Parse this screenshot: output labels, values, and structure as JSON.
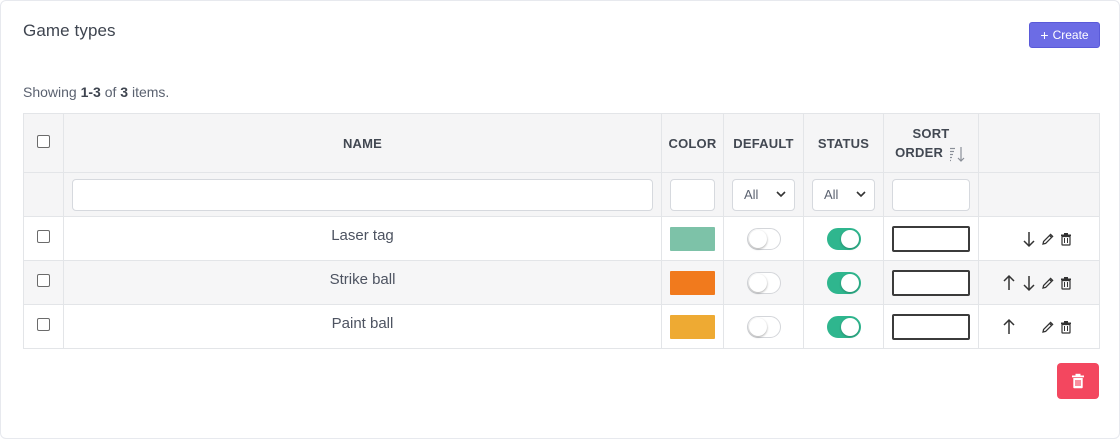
{
  "header": {
    "title": "Game types",
    "create_label": "Create"
  },
  "summary": {
    "prefix": "Showing ",
    "range": "1-3",
    "of": " of ",
    "total": "3",
    "suffix": " items."
  },
  "table": {
    "columns": {
      "name": "NAME",
      "color": "COLOR",
      "default": "DEFAULT",
      "status": "STATUS",
      "sort_order_1": "SORT",
      "sort_order_2": "ORDER"
    },
    "filters": {
      "default_select": "All",
      "status_select": "All"
    },
    "rows": [
      {
        "name": "Laser tag",
        "color": "#7dc2a8",
        "default_on": false,
        "status_on": true
      },
      {
        "name": "Strike ball",
        "color": "#f17a1d",
        "default_on": false,
        "status_on": true
      },
      {
        "name": "Paint ball",
        "color": "#eeaa33",
        "default_on": false,
        "status_on": true
      }
    ]
  },
  "icons": {
    "create": "plus-icon",
    "sort": "sort-descending-icon",
    "move_up": "arrow-up-icon",
    "move_down": "arrow-down-icon",
    "edit": "pencil-icon",
    "delete": "trash-icon"
  },
  "colors": {
    "accent": "#6c6ce5",
    "toggle_on": "#2fb68e",
    "danger": "#f3475f"
  }
}
